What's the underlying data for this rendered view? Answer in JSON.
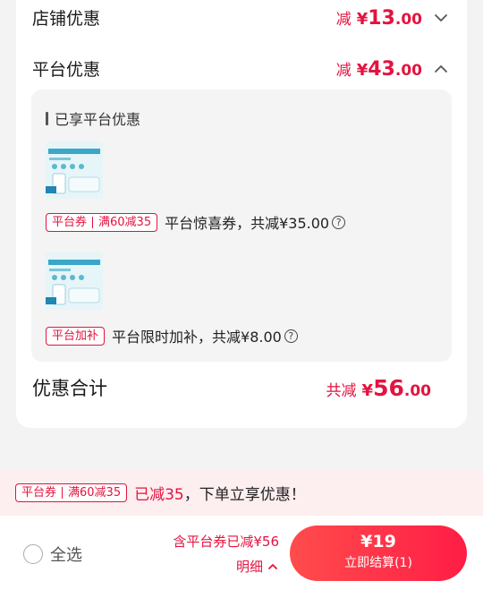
{
  "store_discount": {
    "label": "店铺优惠",
    "prefix": "减",
    "currency": "¥",
    "int": "13",
    "dec": ".00"
  },
  "platform_discount": {
    "label": "平台优惠",
    "prefix": "减",
    "currency": "¥",
    "int": "43",
    "dec": ".00",
    "panel_title": "已享平台优惠",
    "items": [
      {
        "tag_left": "平台券",
        "tag_right": "满60减35",
        "text": "平台惊喜券，共减¥35.00"
      },
      {
        "tag_left": "平台加补",
        "text": "平台限时加补，共减¥8.00"
      }
    ]
  },
  "total": {
    "label": "优惠合计",
    "prefix": "共减",
    "currency": "¥",
    "int": "56",
    "dec": ".00"
  },
  "promo": {
    "tag_left": "平台券",
    "tag_right": "满60减35",
    "text_red": "已减35",
    "text_rest": "，下单立享优惠！"
  },
  "footer": {
    "select_all": "全选",
    "summary_line": "含平台券已减¥56",
    "detail": "明细",
    "price": "¥19",
    "checkout_label": "立即结算(1)"
  },
  "colors": {
    "accent": "#e3133f",
    "button": "#ff2d48"
  }
}
